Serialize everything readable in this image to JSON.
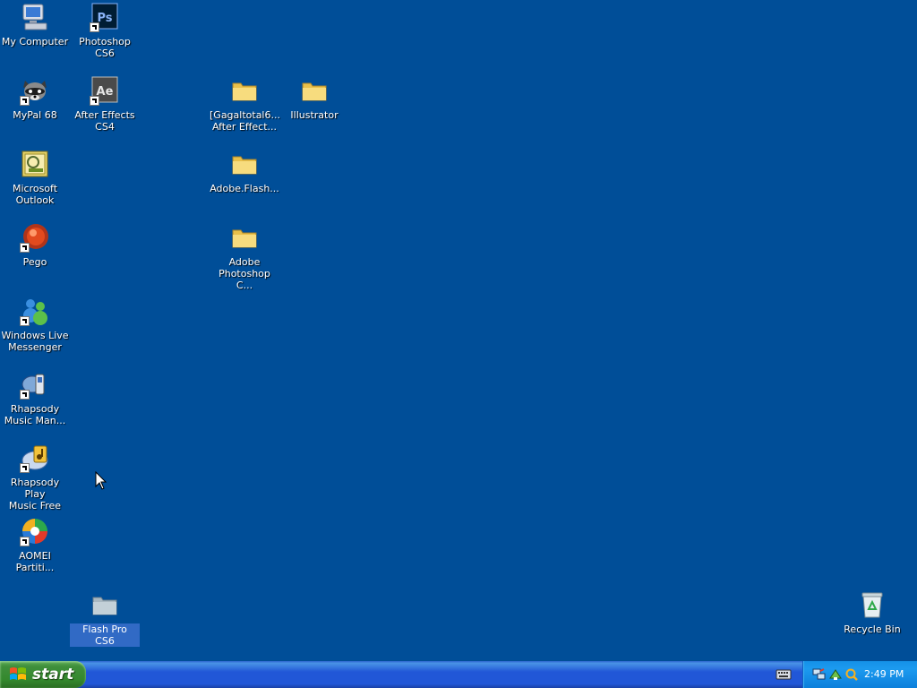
{
  "desktop": {
    "icons": {
      "my_computer": "My Computer",
      "photoshop_cs6": "Photoshop CS6",
      "mypal_68": "MyPal 68",
      "after_effects_cs4": "After Effects\nCS4",
      "gagaltotal_folder": "[Gagaltotal6...\nAfter Effect...",
      "illustrator_folder": "Illustrator",
      "microsoft_outlook": "Microsoft\nOutlook",
      "adobe_flash_folder": "Adobe.Flash...",
      "pego": "Pego",
      "adobe_photoshop_folder": "Adobe\nPhotoshop C...",
      "windows_live_messenger": "Windows Live\nMessenger",
      "rhapsody_music_manager": "Rhapsody\nMusic Man...",
      "rhapsody_play_music_free": "Rhapsody Play\nMusic Free",
      "aomei_partition": "AOMEI\nPartiti...",
      "flash_pro_cs6": "Flash Pro CS6",
      "recycle_bin": "Recycle Bin"
    }
  },
  "taskbar": {
    "start_label": "start",
    "clock": "2:49 PM"
  },
  "colors": {
    "desktop_background": "#004E98",
    "selection": "#316AC5",
    "folder": "#F3D36E"
  }
}
